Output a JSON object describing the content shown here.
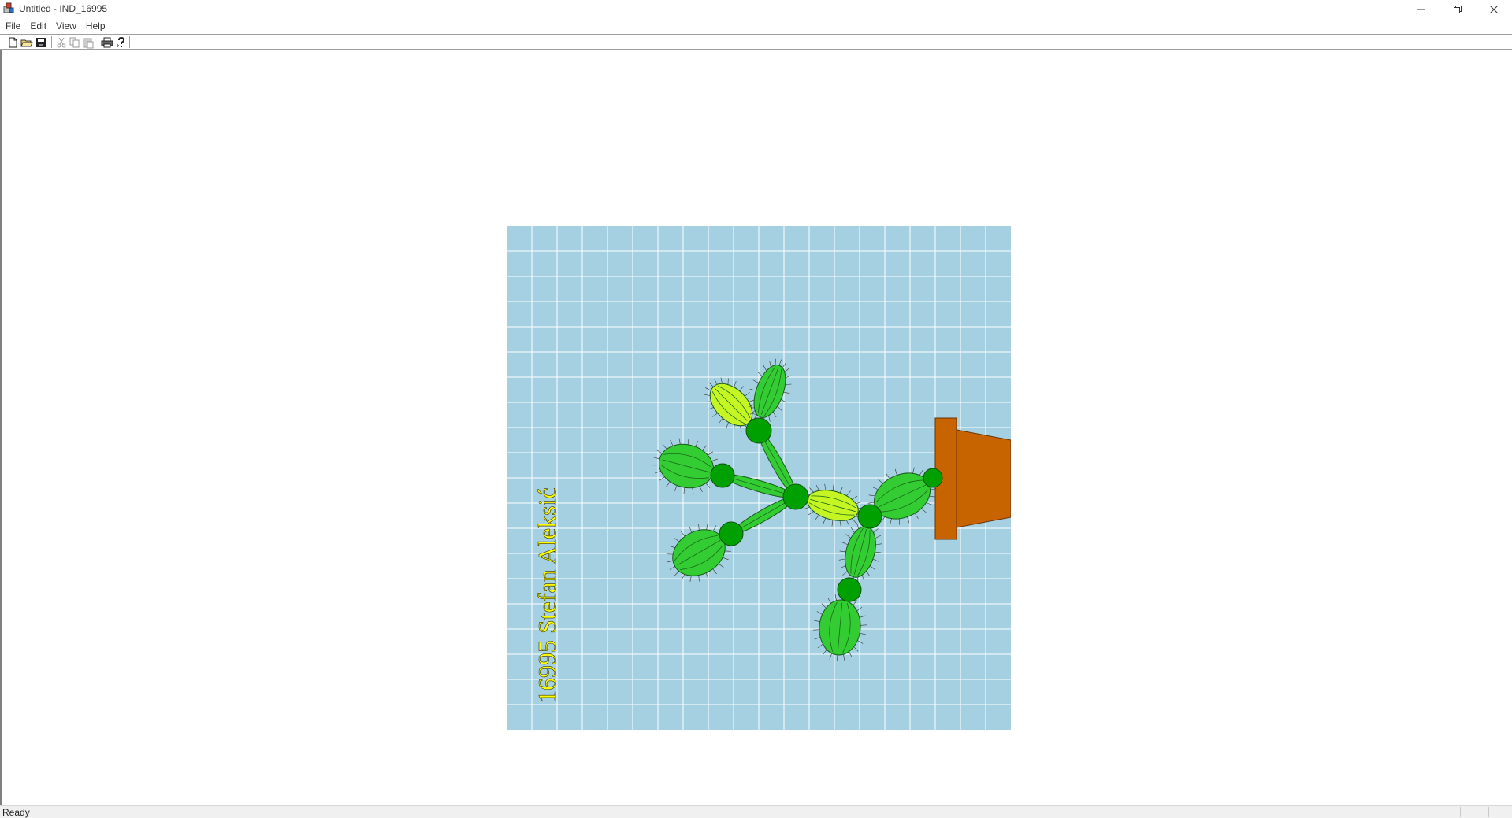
{
  "window": {
    "title": "Untitled - IND_16995"
  },
  "menu": {
    "items": [
      "File",
      "Edit",
      "View",
      "Help"
    ]
  },
  "toolbar": {
    "buttons": [
      "new-icon",
      "open-icon",
      "save-icon",
      "cut-icon",
      "copy-icon",
      "paste-icon",
      "print-icon",
      "about-icon"
    ]
  },
  "canvas": {
    "signature_text": "16995 Stefan Aleksić",
    "colors": {
      "background": "#a4d0e2",
      "grid": "#ffffff",
      "segment_light": "#c6f524",
      "segment_mid": "#33cc33",
      "joint": "#00a000",
      "pot": "#c86400",
      "signature": "#ffff00"
    }
  },
  "status": {
    "text": "Ready"
  }
}
